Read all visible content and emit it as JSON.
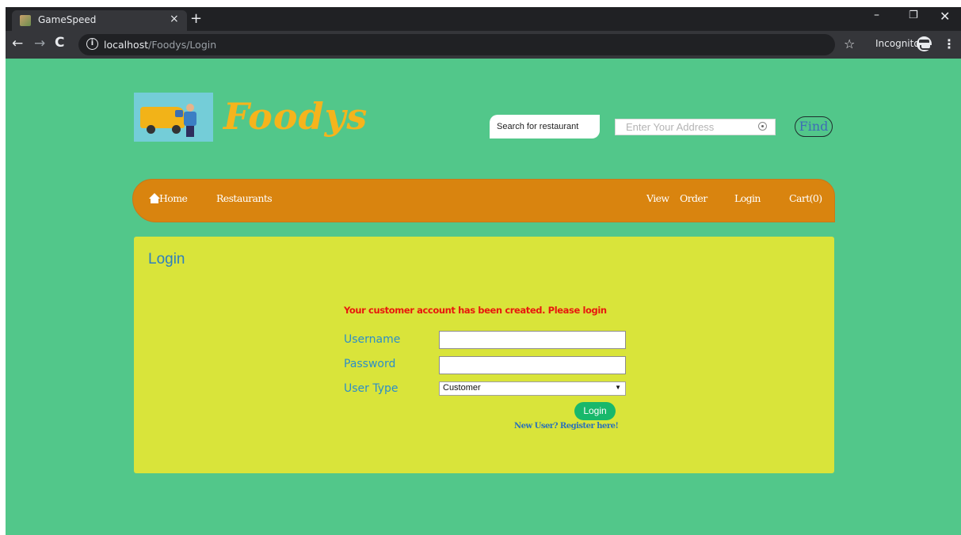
{
  "browser": {
    "tab_title": "GameSpeed",
    "tab_close": "×",
    "new_tab": "+",
    "url_host": "localhost",
    "url_path": "/Foodys/Login",
    "incognito_label": "Incognito",
    "icons": {
      "back": "←",
      "forward": "→",
      "reload": "C",
      "info": "i",
      "star": "☆",
      "menu": "⋮",
      "minimize": "–",
      "restore": "❐",
      "close": "✕"
    }
  },
  "header": {
    "brand": "Foodys",
    "search_placeholder": "Search for restaurant",
    "address_placeholder": "Enter Your Address",
    "find_label": "Find"
  },
  "nav": {
    "home": "Home",
    "restaurants": "Restaurants",
    "view": "View",
    "order": "Order",
    "login": "Login",
    "cart": "Cart(0)"
  },
  "login_panel": {
    "title": "Login",
    "message": "Your customer account has been created. Please login",
    "username_label": "Username",
    "password_label": "Password",
    "usertype_label": "User Type",
    "usertype_value": "Customer",
    "login_button": "Login",
    "register_link": "New User? Register here!"
  },
  "colors": {
    "page_bg": "#52c78a",
    "nav_bg": "#d9840f",
    "panel_bg": "#d9e43a",
    "brand": "#f5b41c",
    "message": "#e8180e",
    "label": "#2c8ec8",
    "login_button": "#18b86b"
  }
}
